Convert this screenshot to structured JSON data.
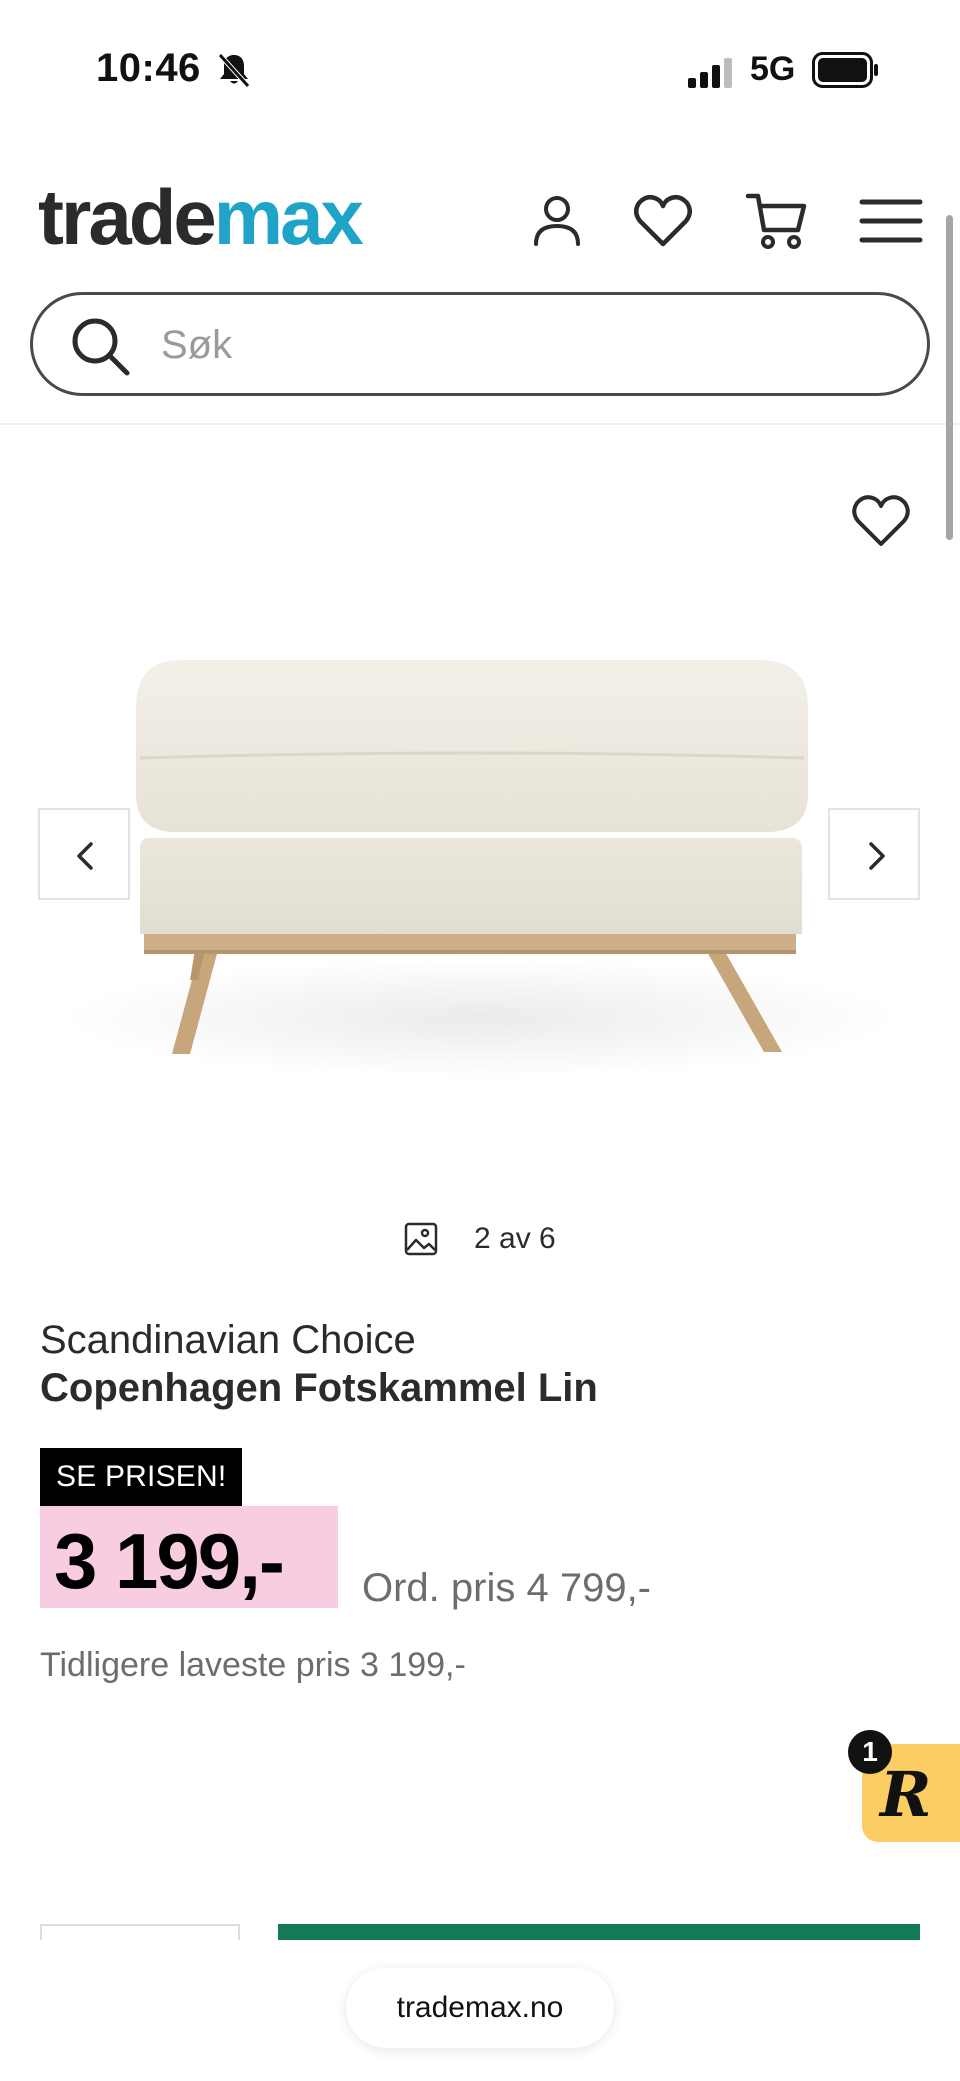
{
  "status_bar": {
    "time": "10:46",
    "network": "5G"
  },
  "header": {
    "logo_part1": "trade",
    "logo_part2": "max",
    "brand_color": "#1fa3c8",
    "icons": [
      "account-icon",
      "heart-icon",
      "cart-icon",
      "menu-icon"
    ]
  },
  "search": {
    "placeholder": "Søk"
  },
  "gallery": {
    "counter": "2 av 6"
  },
  "product": {
    "brand": "Scandinavian Choice",
    "name": "Copenhagen Fotskammel Lin",
    "badge": "SE PRISEN!",
    "price": "3 199,-",
    "ordinary_price": "Ord. pris 4 799,-",
    "lowest_price": "Tidligere laveste pris 3 199,-"
  },
  "rewards": {
    "logo": "R",
    "count": "1"
  },
  "browser": {
    "url": "trademax.no"
  },
  "colors": {
    "price_highlight": "#f9cde1",
    "badge": "#000000",
    "buy_button": "#137a56"
  }
}
